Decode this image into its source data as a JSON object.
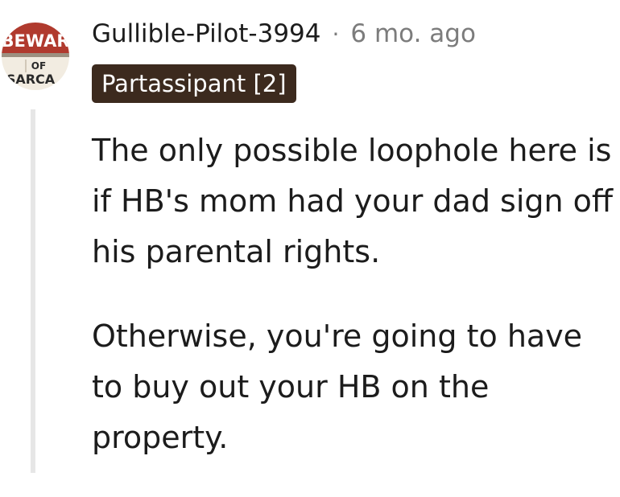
{
  "comment": {
    "username": "Gullible-Pilot-3994",
    "separator": "·",
    "timestamp": "6 mo. ago",
    "flair": "Partassipant [2]",
    "avatar": {
      "icon": "beware-of-sarcasm-sign-avatar",
      "text_top": "BEWAR",
      "text_mid": "OF",
      "text_bottom": "SARCA"
    },
    "paragraphs": [
      "The only possible loophole here is if HB's mom had your dad sign off his parental rights.",
      "Otherwise, you're going to have to buy out your HB on the property."
    ]
  },
  "colors": {
    "text": "#1c1c1c",
    "meta": "#7c7c7c",
    "flair_bg": "#3c2a1e",
    "thread_line": "#e6e6e6",
    "avatar_red": "#b03a2e"
  }
}
